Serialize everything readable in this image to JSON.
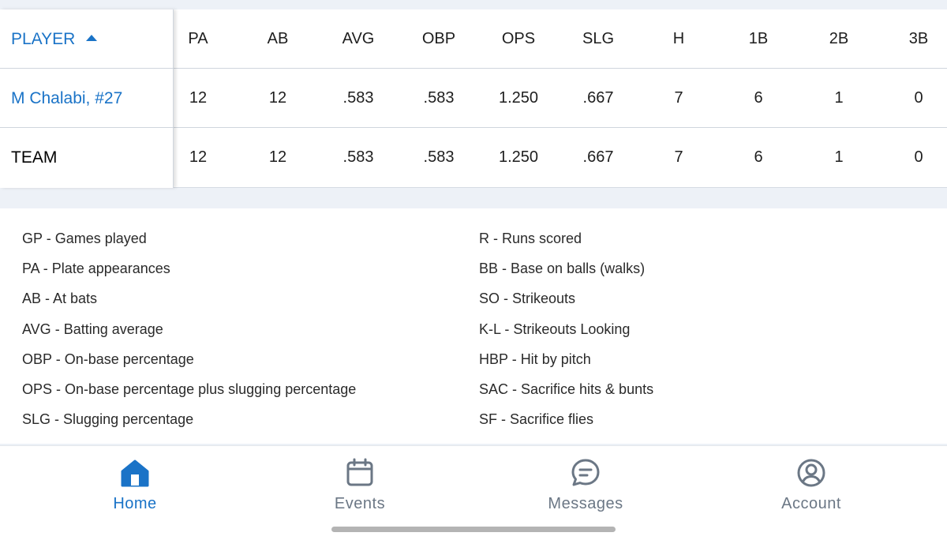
{
  "table": {
    "columns": [
      {
        "key": "player",
        "label": "PLAYER"
      },
      {
        "key": "pa",
        "label": "PA"
      },
      {
        "key": "ab",
        "label": "AB"
      },
      {
        "key": "avg",
        "label": "AVG"
      },
      {
        "key": "obp",
        "label": "OBP"
      },
      {
        "key": "ops",
        "label": "OPS"
      },
      {
        "key": "slg",
        "label": "SLG"
      },
      {
        "key": "h",
        "label": "H"
      },
      {
        "key": "1b",
        "label": "1B"
      },
      {
        "key": "2b",
        "label": "2B"
      },
      {
        "key": "3b",
        "label": "3B"
      }
    ],
    "rows": [
      {
        "name": "M Chalabi, #27",
        "values": [
          "12",
          "12",
          ".583",
          ".583",
          "1.250",
          ".667",
          "7",
          "6",
          "1",
          "0"
        ]
      },
      {
        "name": "TEAM",
        "values": [
          "12",
          "12",
          ".583",
          ".583",
          "1.250",
          ".667",
          "7",
          "6",
          "1",
          "0"
        ]
      }
    ],
    "sort_column": "PLAYER",
    "sort_direction": "ascending"
  },
  "glossary": {
    "left": [
      {
        "abbr": "GP",
        "desc": "Games played"
      },
      {
        "abbr": "PA",
        "desc": "Plate appearances"
      },
      {
        "abbr": "AB",
        "desc": "At bats"
      },
      {
        "abbr": "AVG",
        "desc": "Batting average"
      },
      {
        "abbr": "OBP",
        "desc": "On-base percentage"
      },
      {
        "abbr": "OPS",
        "desc": "On-base percentage plus slugging percentage"
      },
      {
        "abbr": "SLG",
        "desc": "Slugging percentage"
      }
    ],
    "right": [
      {
        "abbr": "R",
        "desc": "Runs scored"
      },
      {
        "abbr": "BB",
        "desc": "Base on balls (walks)"
      },
      {
        "abbr": "SO",
        "desc": "Strikeouts"
      },
      {
        "abbr": "K-L",
        "desc": "Strikeouts Looking"
      },
      {
        "abbr": "HBP",
        "desc": "Hit by pitch"
      },
      {
        "abbr": "SAC",
        "desc": "Sacrifice hits & bunts"
      },
      {
        "abbr": "SF",
        "desc": "Sacrifice flies"
      }
    ],
    "separator": " - "
  },
  "nav": {
    "items": [
      {
        "label": "Home",
        "icon": "home-icon",
        "active": true
      },
      {
        "label": "Events",
        "icon": "calendar-icon",
        "active": false
      },
      {
        "label": "Messages",
        "icon": "chat-icon",
        "active": false
      },
      {
        "label": "Account",
        "icon": "account-icon",
        "active": false
      }
    ]
  },
  "colors": {
    "accent": "#1a73c7",
    "inactive": "#6b7785",
    "background": "#edf1f7"
  }
}
